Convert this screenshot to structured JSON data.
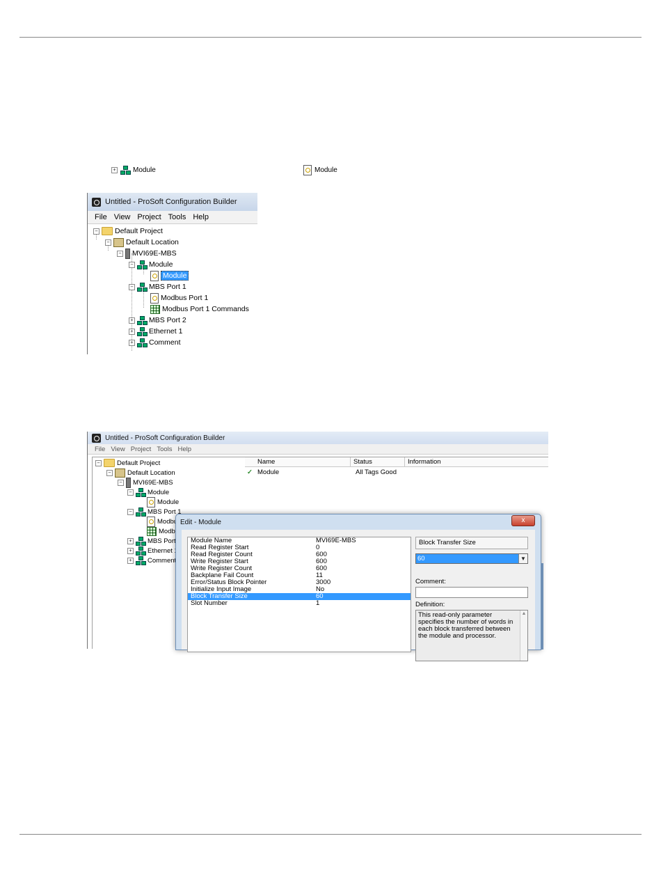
{
  "inline_icons": {
    "item1_label": "Module",
    "item2_label": "Module"
  },
  "shot1": {
    "title": "Untitled - ProSoft Configuration Builder",
    "menu": [
      "File",
      "View",
      "Project",
      "Tools",
      "Help"
    ],
    "tree": {
      "default_project": "Default Project",
      "default_location": "Default Location",
      "device": "MVI69E-MBS",
      "module_group": "Module",
      "module_item": "Module",
      "mbs_port1": "MBS Port 1",
      "modbus_port1": "Modbus Port 1",
      "modbus_port1_commands": "Modbus Port 1 Commands",
      "mbs_port2": "MBS Port 2",
      "ethernet1": "Ethernet 1",
      "comment": "Comment"
    }
  },
  "shot2": {
    "title": "Untitled - ProSoft Configuration Builder",
    "menu": [
      "File",
      "View",
      "Project",
      "Tools",
      "Help"
    ],
    "tree": {
      "default_project": "Default Project",
      "default_location": "Default Location",
      "device": "MVI69E-MBS",
      "module_group": "Module",
      "module_item": "Module",
      "mbs_port1": "MBS Port 1",
      "modbus_port1": "Modbu",
      "modbus_port1_commands": "Modbu",
      "mbs_port2": "MBS Port 2",
      "ethernet1": "Ethernet 1",
      "comment": "Comment"
    },
    "columns": [
      "Name",
      "Status",
      "Information"
    ],
    "row": {
      "name": "Module",
      "status": "All Tags Good",
      "information": ""
    },
    "dialog": {
      "title": "Edit - Module",
      "close": "x",
      "params": [
        {
          "name": "Module Name",
          "value": "MVI69E-MBS"
        },
        {
          "name": "Read Register Start",
          "value": "0"
        },
        {
          "name": "Read Register Count",
          "value": "600"
        },
        {
          "name": "Write Register Start",
          "value": "600"
        },
        {
          "name": "Write Register Count",
          "value": "600"
        },
        {
          "name": "Backplane Fail Count",
          "value": "11"
        },
        {
          "name": "Error/Status Block Pointer",
          "value": "3000"
        },
        {
          "name": "Initialize Input Image",
          "value": "No"
        },
        {
          "name": "Block Transfer Size",
          "value": "60"
        },
        {
          "name": "Slot Number",
          "value": "1"
        }
      ],
      "selected_param": "Block Transfer Size",
      "field_heading": "Block Transfer Size",
      "field_value": "60",
      "comment_label": "Comment:",
      "definition_label": "Definition:",
      "definition_text": "This read-only parameter specifies the number of words in each block transferred between the module and processor."
    }
  }
}
